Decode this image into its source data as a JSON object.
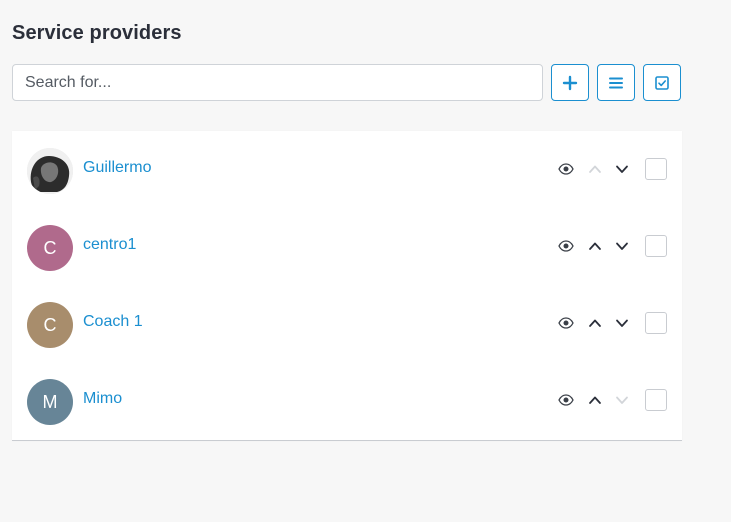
{
  "title": "Service providers",
  "search": {
    "placeholder": "Search for..."
  },
  "toolbar": {
    "add_icon": "plus-icon",
    "list_icon": "list-icon",
    "select_icon": "checkbox-icon",
    "accent_color": "#1b8fd0"
  },
  "providers": [
    {
      "name": "Guillermo",
      "initial": "",
      "avatar_type": "photo",
      "avatar_color": "#3a3a3a",
      "can_move_up": false,
      "can_move_down": true
    },
    {
      "name": "centro1",
      "initial": "C",
      "avatar_type": "initial",
      "avatar_color": "#b06a8c",
      "can_move_up": true,
      "can_move_down": true
    },
    {
      "name": "Coach 1",
      "initial": "C",
      "avatar_type": "initial",
      "avatar_color": "#a88d6c",
      "can_move_up": true,
      "can_move_down": true
    },
    {
      "name": "Mimo",
      "initial": "M",
      "avatar_type": "initial",
      "avatar_color": "#678597",
      "can_move_up": true,
      "can_move_down": false
    }
  ]
}
